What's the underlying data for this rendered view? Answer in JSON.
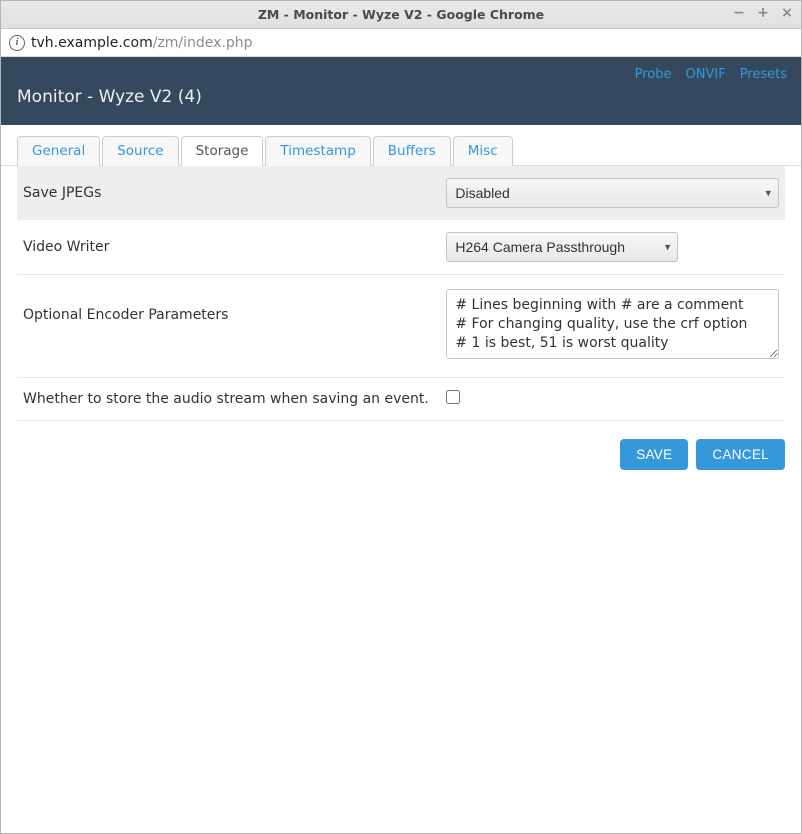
{
  "window": {
    "title": "ZM - Monitor - Wyze V2 - Google Chrome"
  },
  "address": {
    "host": "tvh.example.com",
    "path": "/zm/index.php"
  },
  "header": {
    "links": {
      "probe": "Probe",
      "onvif": "ONVIF",
      "presets": "Presets"
    },
    "title": "Monitor - Wyze V2 (4)"
  },
  "tabs": {
    "general": "General",
    "source": "Source",
    "storage": "Storage",
    "timestamp": "Timestamp",
    "buffers": "Buffers",
    "misc": "Misc",
    "active": "storage"
  },
  "form": {
    "saveJpegs": {
      "label": "Save JPEGs",
      "value": "Disabled"
    },
    "videoWriter": {
      "label": "Video Writer",
      "value": "H264 Camera Passthrough"
    },
    "encoderParams": {
      "label": "Optional Encoder Parameters",
      "value": "# Lines beginning with # are a comment\n# For changing quality, use the crf option\n# 1 is best, 51 is worst quality"
    },
    "storeAudio": {
      "label": "Whether to store the audio stream when saving an event.",
      "checked": false
    }
  },
  "buttons": {
    "save": "SAVE",
    "cancel": "CANCEL"
  }
}
